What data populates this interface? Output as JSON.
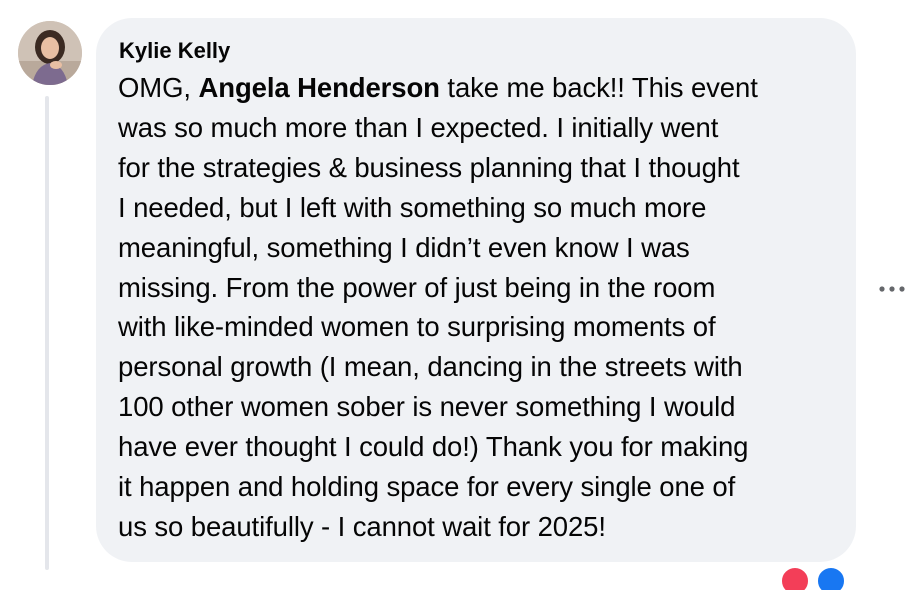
{
  "comment": {
    "author_name": "Kylie Kelly",
    "avatar_icon": "avatar-photo-icon",
    "text_lines": [
      {
        "before": "OMG, ",
        "mention": "Angela Henderson",
        "after": " take me back!! This event"
      },
      {
        "text": "was so much more than I expected. I initially went"
      },
      {
        "text": "for the strategies & business planning that I thought"
      },
      {
        "text": "I needed, but I left with something so much more"
      },
      {
        "text": "meaningful, something I didn’t even know I was"
      },
      {
        "text": "missing. From the power of just being in the room"
      },
      {
        "text": "with like-minded women to surprising moments of"
      },
      {
        "text": "personal growth (I mean, dancing in the streets with"
      },
      {
        "text": "100 other women sober is never something I would"
      },
      {
        "text": "have ever thought I could do!) Thank you for making"
      },
      {
        "text": "it happen and holding space for every single one of"
      },
      {
        "text": "us so beautifully - I cannot wait for 2025!"
      }
    ],
    "more_options_icon": "more-horizontal-icon",
    "reactions": [
      {
        "icon": "love-reaction-icon",
        "color": "#f33e58"
      },
      {
        "icon": "like-reaction-icon",
        "color": "#1877f2"
      }
    ]
  },
  "colors": {
    "bubble": "#f0f2f5",
    "text": "#050505",
    "thread_line": "#e4e6eb",
    "icon": "#65676b"
  }
}
